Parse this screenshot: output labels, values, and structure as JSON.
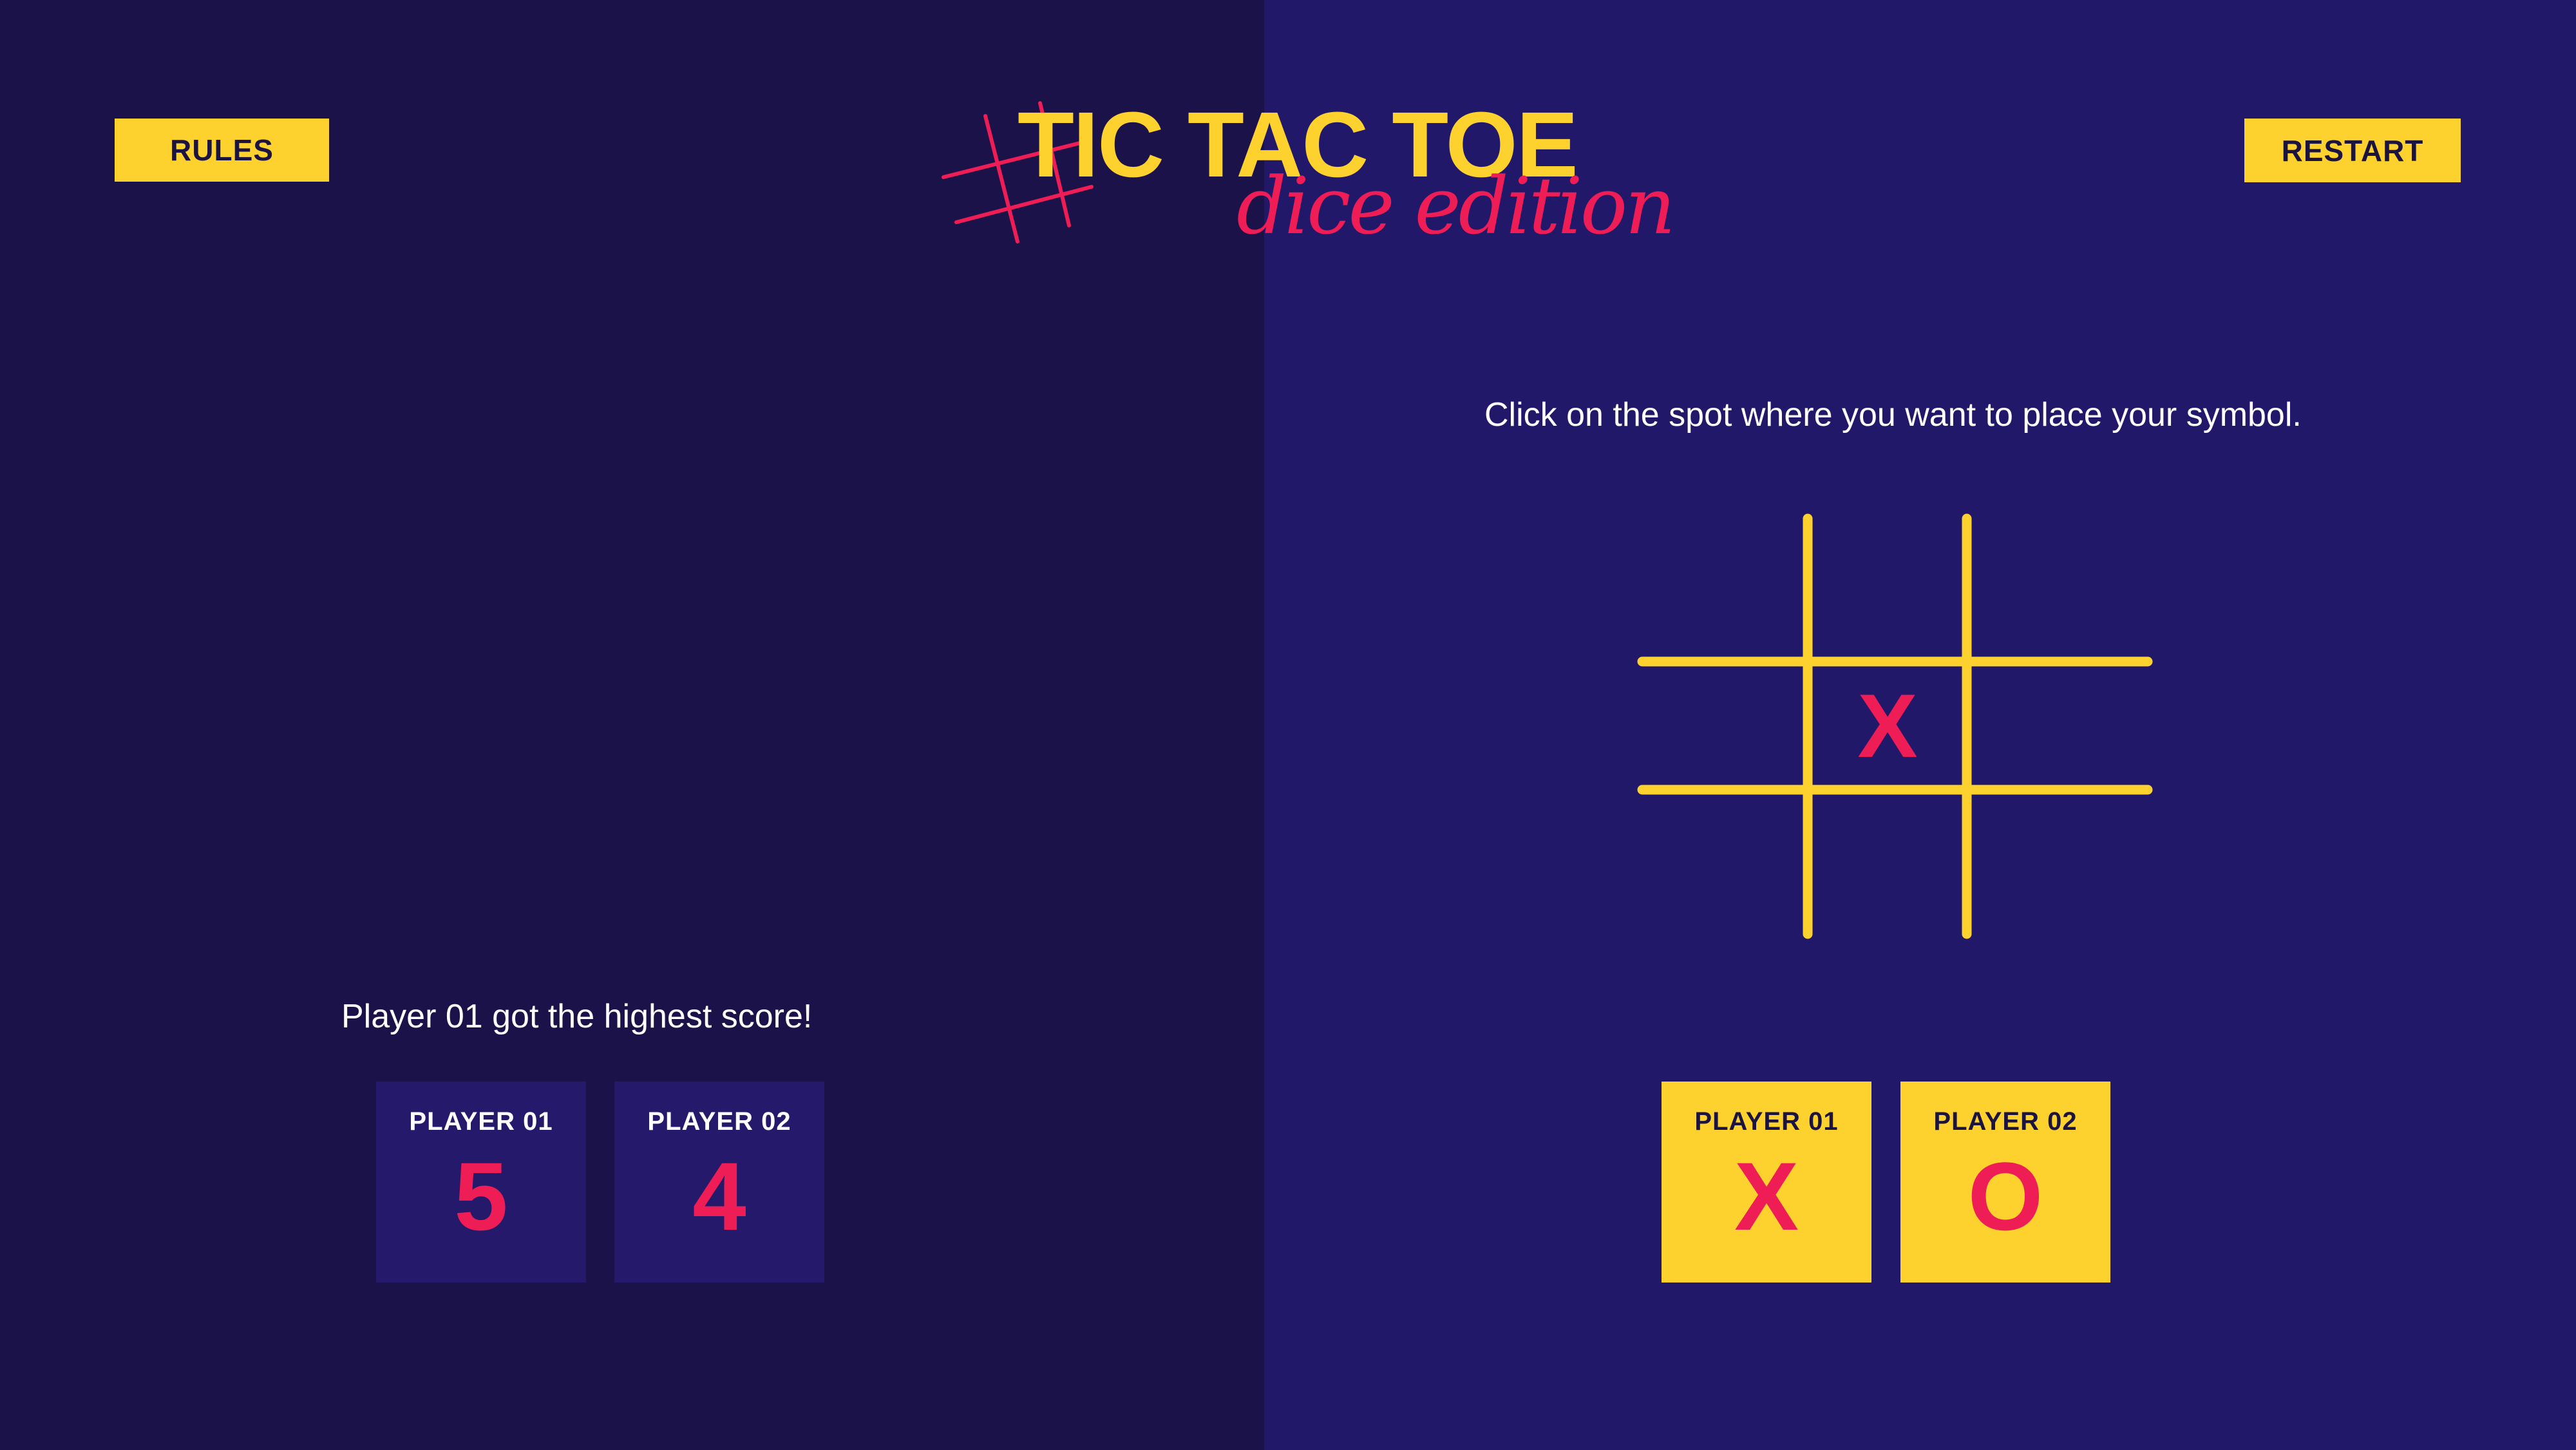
{
  "header": {
    "rules_label": "RULES",
    "restart_label": "RESTART",
    "title": "TIC TAC TOE",
    "subtitle": "dice edition"
  },
  "instruction": "Click on the spot where you want to place your symbol.",
  "result_message": "Player 01 got the highest score!",
  "scores": [
    {
      "player": "PLAYER 01",
      "value": "5"
    },
    {
      "player": "PLAYER 02",
      "value": "4"
    }
  ],
  "symbols": [
    {
      "player": "PLAYER 01",
      "symbol": "X"
    },
    {
      "player": "PLAYER 02",
      "symbol": "O"
    }
  ],
  "board": {
    "cells": [
      "",
      "",
      "",
      "",
      "X",
      "",
      "",
      "",
      ""
    ]
  },
  "colors": {
    "background_left": "#1c124a",
    "background_right": "#22186a",
    "accent_yellow": "#fdd22f",
    "accent_pink": "#ee1d55",
    "text": "#ffffff"
  }
}
